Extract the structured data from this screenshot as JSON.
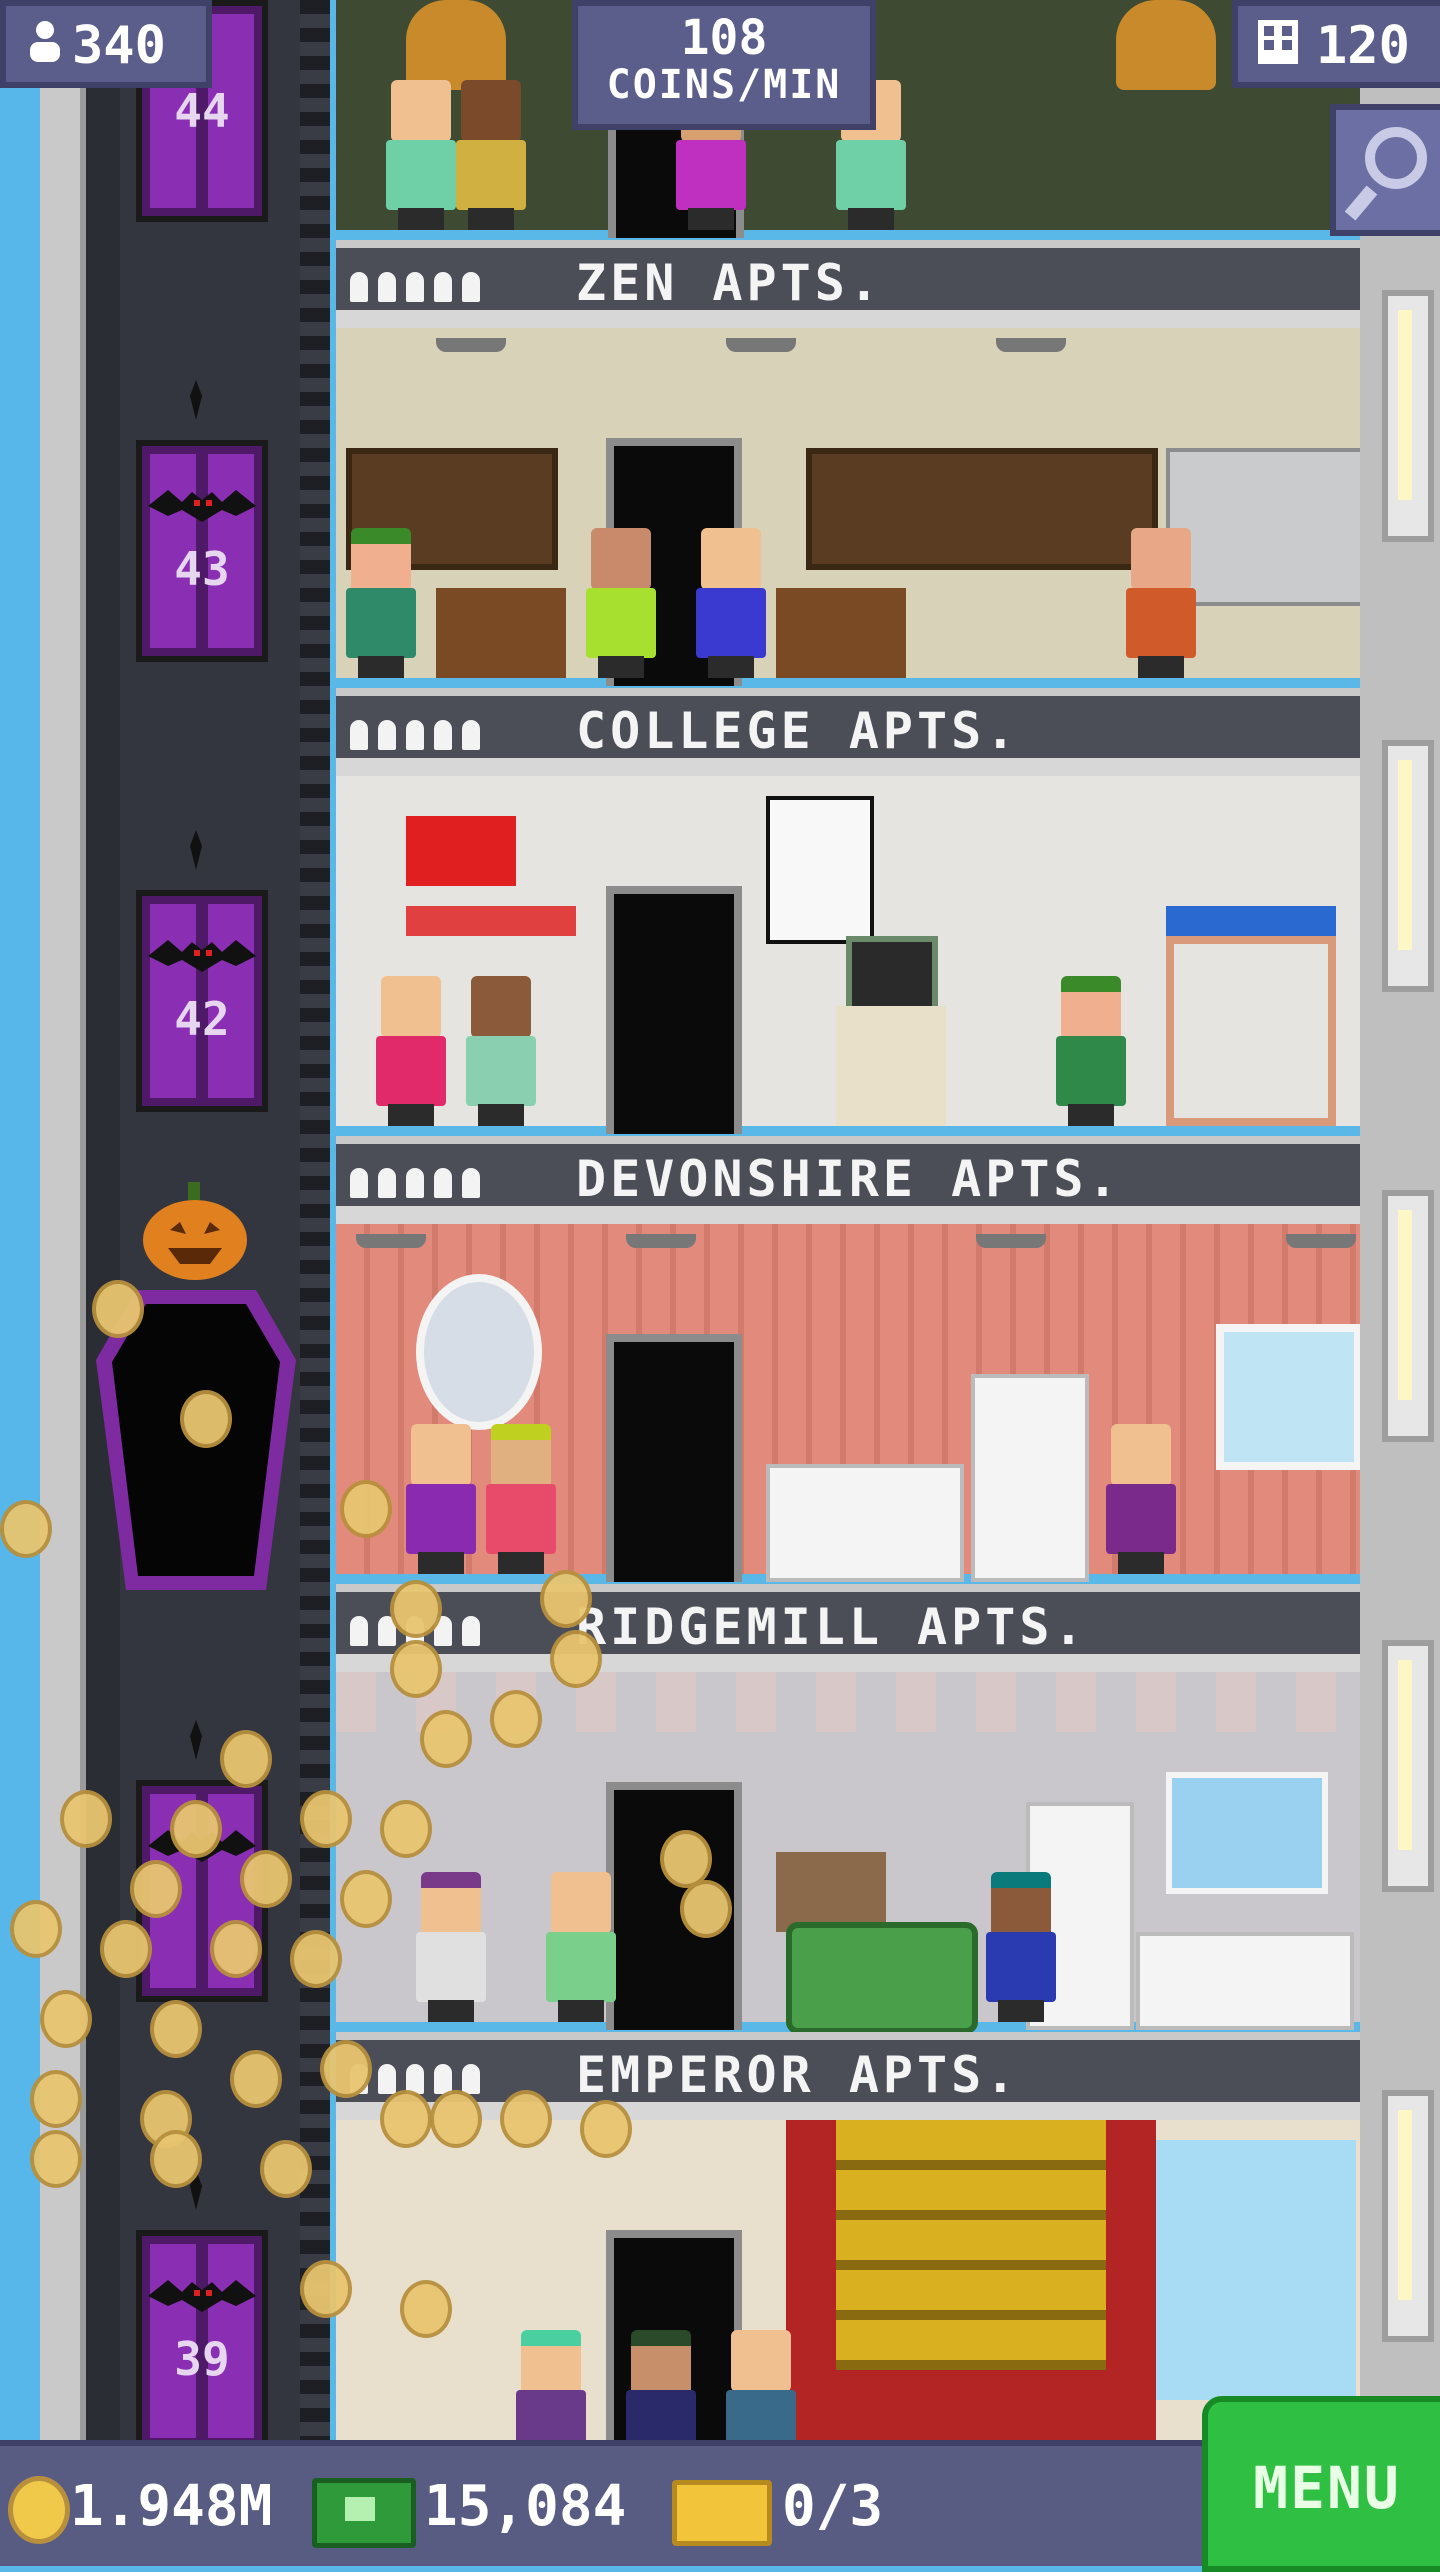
{
  "hud": {
    "population": "340",
    "coins_per_min_value": "108",
    "coins_per_min_unit": "COINS/MIN",
    "tower_bux": "120"
  },
  "elevator": {
    "floors_shown": [
      "44",
      "43",
      "42",
      "39"
    ]
  },
  "floors": [
    {
      "name": "ZEN APTS.",
      "room_color": "#3e4a32",
      "residents": 5
    },
    {
      "name": "COLLEGE APTS.",
      "room_color": "#d8d2b8",
      "residents": 5
    },
    {
      "name": "DEVONSHIRE APTS.",
      "room_color": "#e6e4e0",
      "residents": 5
    },
    {
      "name": "RIDGEMILL APTS.",
      "room_color": "#e28a7c",
      "residents": 5
    },
    {
      "name": "EMPEROR APTS.",
      "room_color": "#c9c6cc",
      "residents": 5
    }
  ],
  "bottom_bar": {
    "coins": "1.948M",
    "bux": "15,084",
    "tickets": "0/3",
    "menu_label": "MENU"
  },
  "colors": {
    "hud_bg": "#5b5e8a",
    "menu_green": "#2fbf43",
    "elevator_purple": "#8a2fb4",
    "coin_gold": "#e8c570"
  },
  "icons": [
    "population-icon",
    "tower-bux-icon",
    "search-icon",
    "coin-icon",
    "bux-icon",
    "ticket-icon",
    "bat-icon",
    "pumpkin-icon"
  ]
}
